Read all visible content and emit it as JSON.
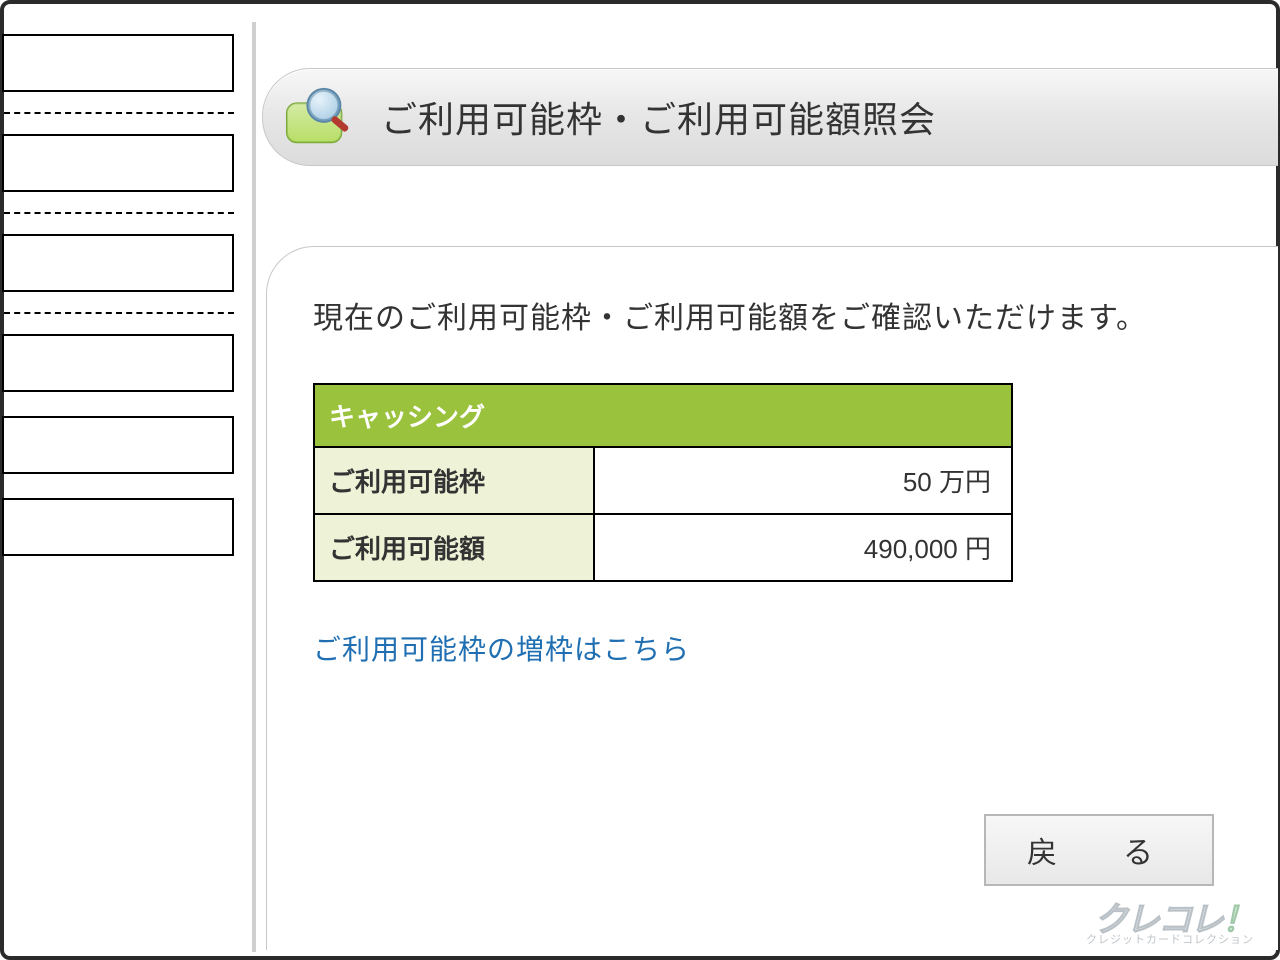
{
  "title_bar": {
    "title": "ご利用可能枠・ご利用可能額照会"
  },
  "content": {
    "intro": "現在のご利用可能枠・ご利用可能額をご確認いただけます。",
    "table_header": "キャッシング",
    "rows": [
      {
        "label": "ご利用可能枠",
        "value": "50 万円"
      },
      {
        "label": "ご利用可能額",
        "value": "490,000 円"
      }
    ],
    "increase_link": "ご利用可能枠の増枠はこちら",
    "back_button": "戻　る"
  },
  "watermark": {
    "main": "クレコレ",
    "bang": "！",
    "sub": "クレジットカードコレクション"
  }
}
